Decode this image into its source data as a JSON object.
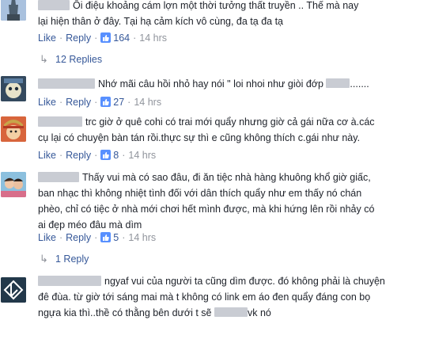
{
  "comments": [
    {
      "lines": [
        "Ôi điệu khoảng cám lợn một thời tưởng thất truyền .. Thế mà nay",
        "lại hiện thân ở đây. Tại hạ cảm kích vô cùng, đa tạ đa tạ"
      ],
      "like_label": "Like",
      "reply_label": "Reply",
      "likes": "164",
      "time": "14 hrs",
      "avatar_icon": "statue-icon"
    },
    {
      "lines": [
        "Nhớ mãi câu hồi nhỏ hay nói \" loi nhoi như giòi đớp",
        "......."
      ],
      "like_label": "Like",
      "reply_label": "Reply",
      "likes": "27",
      "time": "14 hrs",
      "avatar_icon": "cartoon-avatar-icon"
    },
    {
      "lines": [
        "trc giờ ở quê cohi có trai mới quẩy nhưng giờ cả gái nữa cơ à.các",
        "cụ lại có chuyện bàn tán rồi.thực sự thì e cũng không thích c.gái như này."
      ],
      "like_label": "Like",
      "reply_label": "Reply",
      "likes": "8",
      "time": "14 hrs",
      "avatar_icon": "anime-avatar-icon"
    },
    {
      "lines": [
        "Thấy vui mà có sao đâu, đi ăn tiệc nhà hàng khuông khổ giờ giấc,",
        "ban nhạc thì không nhiệt tình đối với dân thích quẩy như em thấy nó chán",
        "phèo, chỉ có tiệc ở nhà mới chơi hết mình được, mà khi hứng lên rồi nhảy có",
        "ai đẹp méo đâu mà dìm"
      ],
      "like_label": "Like",
      "reply_label": "Reply",
      "likes": "5",
      "time": "14 hrs",
      "avatar_icon": "couple-photo-icon"
    },
    {
      "lines": [
        "ngyaf vui của người ta cũng dìm được. đó không phải là chuyện",
        "đê đùa. từ giờ tới sáng mai mà t không có link em áo đen quẩy đáng con bọ",
        "ngựa kia thì..thề có thằng bên dưới t sẽ",
        "vk nó"
      ],
      "avatar_icon": "linkin-park-logo-icon"
    }
  ],
  "reply_threads": [
    {
      "label": "12 Replies"
    },
    {
      "label": "1 Reply"
    }
  ]
}
